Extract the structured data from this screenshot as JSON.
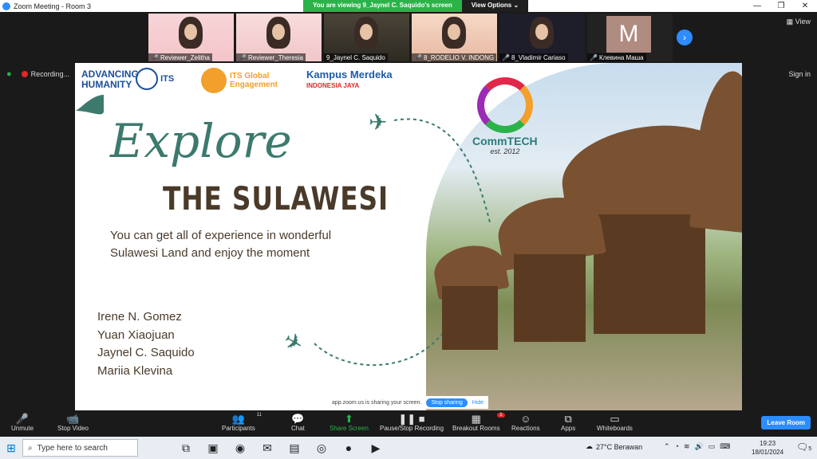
{
  "window": {
    "title": "Zoom Meeting - Room 3",
    "minimize": "—",
    "maximize": "❐",
    "close": "✕"
  },
  "banner": {
    "viewing": "You are viewing 9_Jaynel C. Saquido's screen",
    "options": "View Options ⌄"
  },
  "participants_strip": [
    {
      "name": "Reviewer_Zelitha",
      "muted": true
    },
    {
      "name": "Reviewer_Theresia",
      "muted": true
    },
    {
      "name": "9_Jaynel C. Saquido",
      "muted": false
    },
    {
      "name": "8_RODELIO V. INDONG",
      "muted": true
    },
    {
      "name": "8_Vladimir Cariaso",
      "muted": true
    },
    {
      "name": "Клевина Маша",
      "muted": true,
      "initial": "M"
    }
  ],
  "view_button": "▦ View",
  "recording": {
    "label": "Recording...",
    "pause": "❚❚",
    "stop": "■"
  },
  "signin": "Sign in",
  "slide": {
    "logos": {
      "its_adv": "ADVANCING HUMANITY",
      "its": "ITS",
      "global": "ITS Global Engagement",
      "kampus": "Kampus Merdeka",
      "kampus_sub": "INDONESIA JAYA"
    },
    "commtech": {
      "name": "CommTECH",
      "est": "est. 2012"
    },
    "title_script": "Explore",
    "title_main": "THE SULAWESI",
    "tagline": "You can get all of experience in wonderful Sulawesi Land and enjoy the moment",
    "members": [
      "Irene N. Gomez",
      "Yuan Xiaojuan",
      "Jaynel C. Saquido",
      "Mariia Klevina"
    ]
  },
  "share_bar": {
    "text": "app.zoom.us is sharing your screen.",
    "stop": "Stop sharing",
    "hide": "Hide"
  },
  "toolbar": {
    "unmute": "Unmute",
    "stop_video": "Stop Video",
    "participants": "Participants",
    "participants_count": "11",
    "chat": "Chat",
    "share": "Share Screen",
    "record": "Pause/Stop Recording",
    "breakout": "Breakout Rooms",
    "breakout_badge": "1",
    "reactions": "Reactions",
    "apps": "Apps",
    "whiteboards": "Whiteboards",
    "leave": "Leave Room"
  },
  "taskbar": {
    "search_placeholder": "Type here to search",
    "weather": "27°C  Berawan",
    "time": "19:23",
    "date": "18/01/2024",
    "notif_count": "5"
  }
}
